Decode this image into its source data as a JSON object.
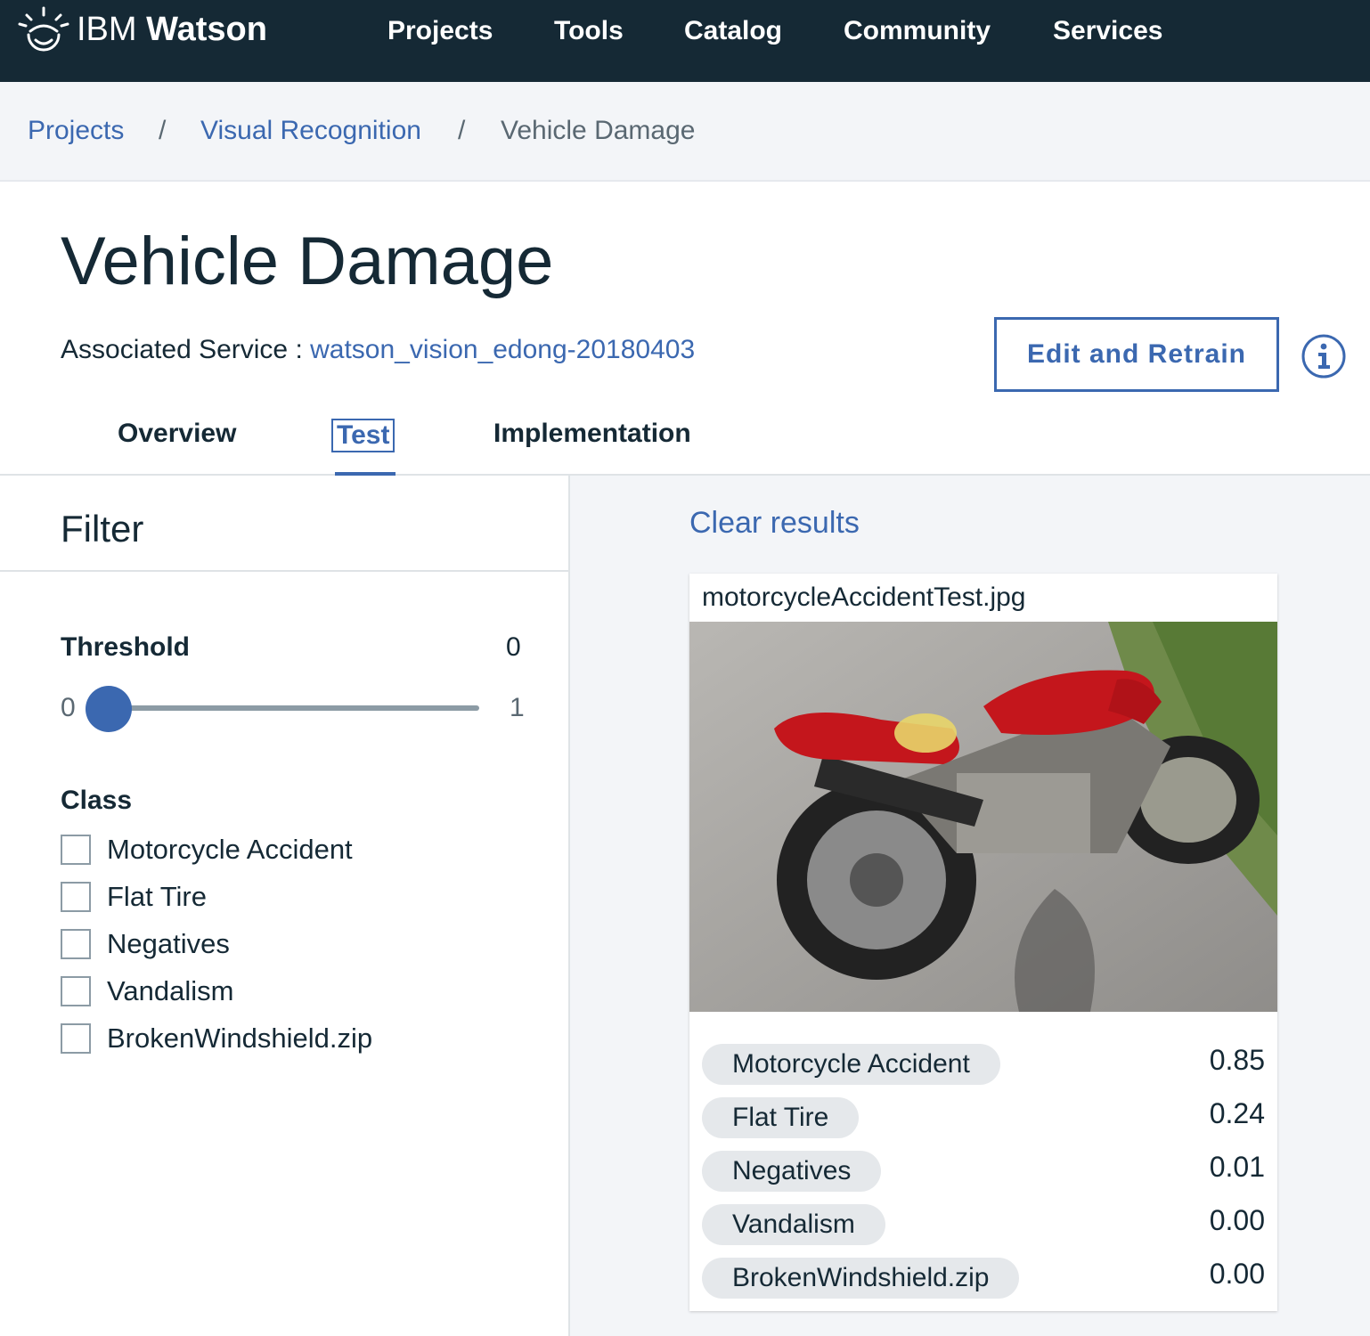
{
  "topnav": {
    "brand_prefix": "IBM",
    "brand_name": "Watson",
    "items": [
      "Projects",
      "Tools",
      "Catalog",
      "Community",
      "Services"
    ]
  },
  "breadcrumb": {
    "items": [
      "Projects",
      "Visual Recognition",
      "Vehicle Damage"
    ],
    "separator": "/"
  },
  "header": {
    "title": "Vehicle Damage",
    "associated_label": "Associated Service : ",
    "associated_service": "watson_vision_edong-20180403",
    "retrain_label": "Edit and Retrain",
    "info_icon": "info-icon"
  },
  "tabs": [
    {
      "label": "Overview",
      "active": false
    },
    {
      "label": "Test",
      "active": true
    },
    {
      "label": "Implementation",
      "active": false
    }
  ],
  "filter": {
    "title": "Filter",
    "threshold_label": "Threshold",
    "threshold_value": "0",
    "slider_min": "0",
    "slider_max": "1",
    "slider_position": 0,
    "class_label": "Class",
    "classes": [
      "Motorcycle Accident",
      "Flat Tire",
      "Negatives",
      "Vandalism",
      "BrokenWindshield.zip"
    ]
  },
  "results": {
    "clear_label": "Clear results",
    "filename": "motorcycleAccidentTest.jpg",
    "scores": [
      {
        "label": "Motorcycle Accident",
        "score": "0.85"
      },
      {
        "label": "Flat Tire",
        "score": "0.24"
      },
      {
        "label": "Negatives",
        "score": "0.01"
      },
      {
        "label": "Vandalism",
        "score": "0.00"
      },
      {
        "label": "BrokenWindshield.zip",
        "score": "0.00"
      }
    ]
  },
  "colors": {
    "nav_bg": "#152935",
    "accent": "#3b68b0",
    "panel_bg": "#f3f5f8"
  }
}
